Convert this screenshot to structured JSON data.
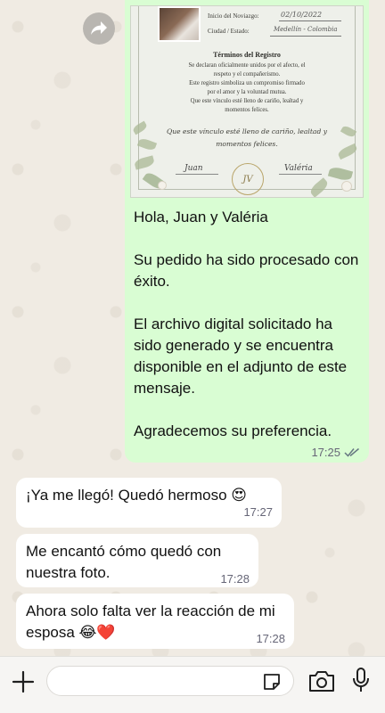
{
  "chat": {
    "outgoing": {
      "certificate": {
        "date_label": "Inicio del Noviazgo:",
        "date_value": "02/10/2022",
        "place_label": "Ciudad / Estado:",
        "place_value": "Medellín - Colombia",
        "title": "Términos del Registro",
        "body_lines": [
          "Se declaran oficialmente unidos por el afecto, el",
          "respeto y el compañerismo.",
          "Este registro simboliza un compromiso firmado",
          "por el amor y la voluntad mutua.",
          "Que este vínculo esté lleno de cariño, lealtad y",
          "momentos felices."
        ],
        "vow_lines": [
          "Que este vínculo esté lleno de cariño, lealtad y",
          "momentos felices."
        ],
        "signature_left": "Juan",
        "signature_right": "Valéria",
        "seal_text": "JV"
      },
      "paragraphs": [
        "Hola, Juan y Valéria",
        "Su pedido ha sido procesado con éxito.",
        "El archivo digital solicitado ha sido generado y se encuentra disponible en el adjunto de este mensaje.",
        "Agradecemos su preferencia."
      ],
      "time": "17:25"
    },
    "incoming": [
      {
        "text": "¡Ya me llegó! Quedó hermoso 😍",
        "time": "17:27"
      },
      {
        "text": "Me encantó cómo quedó con nuestra foto.",
        "time": "17:28"
      },
      {
        "text": "Ahora solo falta ver la reacción de mi esposa 😂❤️",
        "time": "17:28"
      }
    ]
  },
  "input": {
    "value": "",
    "placeholder": ""
  },
  "icons": {
    "forward": "forward-icon",
    "plus": "plus-icon",
    "sticker": "sticker-icon",
    "camera": "camera-icon",
    "mic": "microphone-icon",
    "read": "double-check-icon"
  },
  "colors": {
    "outgoing_bubble": "#d9fdd3",
    "incoming_bubble": "#ffffff",
    "read_tick": "#667781"
  }
}
